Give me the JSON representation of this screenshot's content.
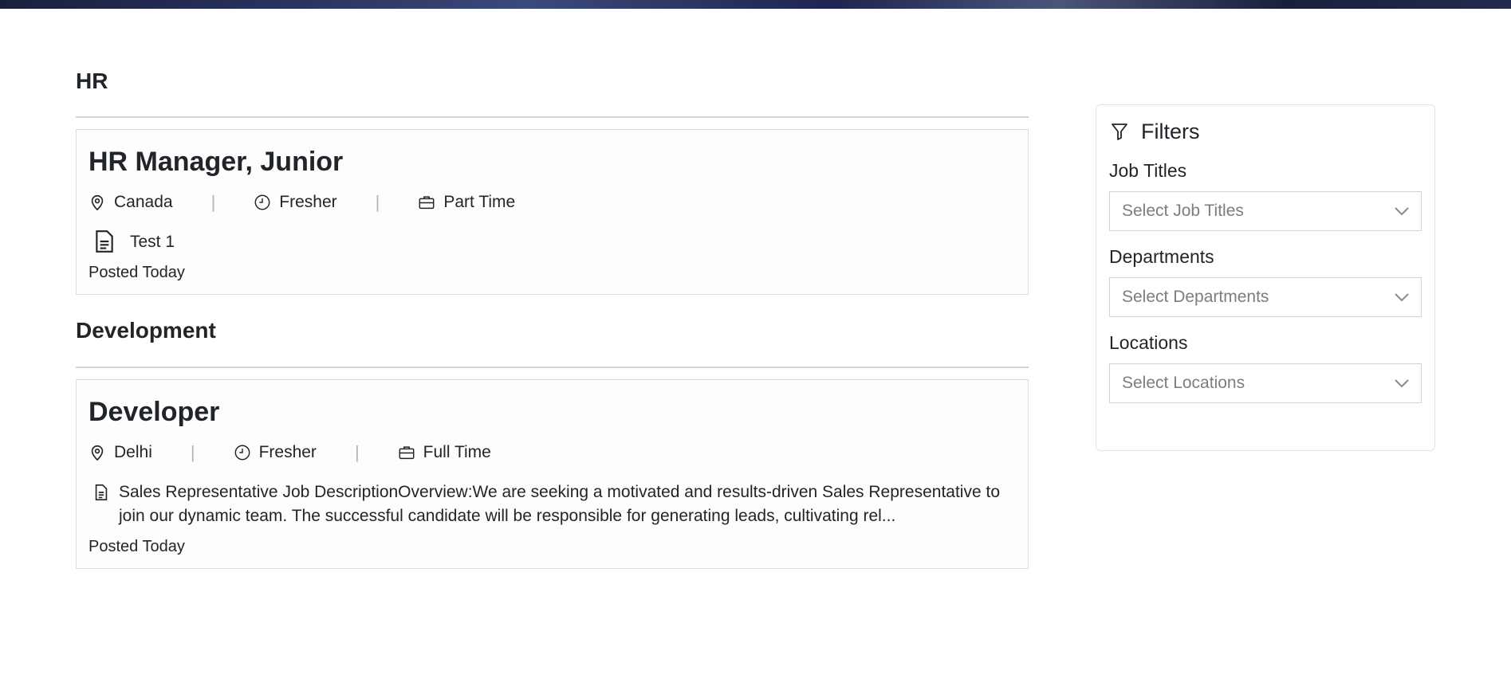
{
  "departments": [
    {
      "name": "HR",
      "job": {
        "title": "HR Manager, Junior",
        "location": "Canada",
        "experience": "Fresher",
        "type": "Part Time",
        "description": "Test 1",
        "posted": "Posted Today"
      }
    },
    {
      "name": "Development",
      "job": {
        "title": "Developer",
        "location": "Delhi",
        "experience": "Fresher",
        "type": "Full Time",
        "description": "Sales Representative Job DescriptionOverview:We are seeking a motivated and results-driven Sales Representative to join our dynamic team. The successful candidate will be responsible for generating leads, cultivating rel...",
        "posted": "Posted Today"
      }
    }
  ],
  "filters": {
    "title": "Filters",
    "job_titles_label": "Job Titles",
    "job_titles_placeholder": "Select Job Titles",
    "departments_label": "Departments",
    "departments_placeholder": "Select Departments",
    "locations_label": "Locations",
    "locations_placeholder": "Select Locations"
  },
  "separator": "|",
  "icons": {
    "location": "map-pin-icon",
    "experience": "clock-icon",
    "type": "briefcase-icon",
    "description": "document-icon",
    "filter": "filter-icon",
    "dropdown": "chevron-down-icon"
  }
}
